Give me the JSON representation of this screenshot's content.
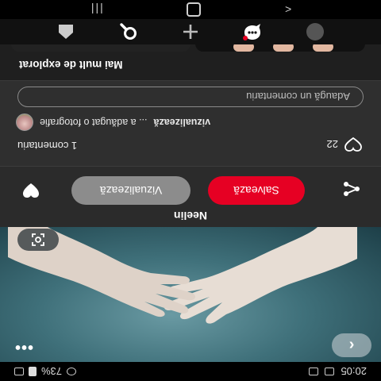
{
  "status_bar": {
    "time": "20:05",
    "battery": "73%"
  },
  "pin": {
    "author": "Neelin"
  },
  "actions": {
    "save_label": "Salvează",
    "visit_label": "Vizualizează"
  },
  "comments": {
    "reaction_count": "22",
    "count_label": "1 comentariu",
    "preview_author": "vizualizează",
    "preview_text": "... a adăugat o fotografie",
    "input_placeholder": "Adaugă un comentariu"
  },
  "explore": {
    "title": "Mai mult de explorat"
  },
  "icons": {
    "back": "chevron-left-icon",
    "more": "more-icon",
    "lens": "lens-icon",
    "share": "share-icon",
    "reaction": "heart-icon",
    "home": "home-icon",
    "search": "search-icon",
    "add": "plus-icon",
    "messages": "chat-icon",
    "profile": "profile-icon"
  },
  "colors": {
    "accent": "#e60023",
    "secondary_button": "#8c8c8c",
    "background": "#2b2b2b"
  }
}
